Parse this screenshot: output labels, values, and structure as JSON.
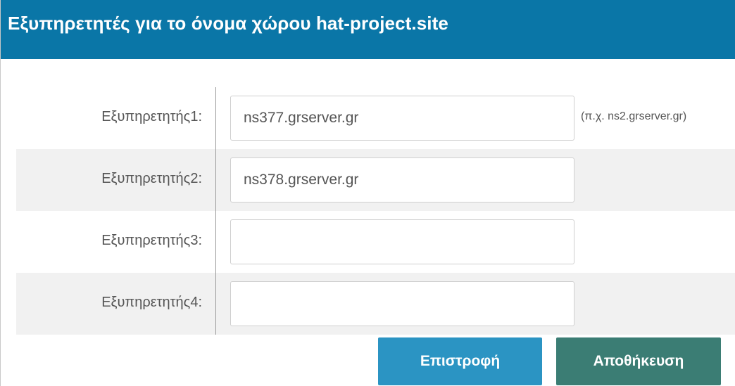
{
  "header": {
    "title": "Εξυπηρετητές για το όνομα χώρου hat-project.site"
  },
  "rows": [
    {
      "label": "Εξυπηρετητής1:",
      "value": "ns377.grserver.gr",
      "hint": "(π.χ. ns2.grserver.gr)"
    },
    {
      "label": "Εξυπηρετητής2:",
      "value": "ns378.grserver.gr"
    },
    {
      "label": "Εξυπηρετητής3:",
      "value": ""
    },
    {
      "label": "Εξυπηρετητής4:",
      "value": ""
    }
  ],
  "actions": {
    "back_label": "Επιστροφή",
    "save_label": "Αποθήκευση"
  },
  "colors": {
    "header_bg": "#0a76a7",
    "back_button": "#2b94c3",
    "save_button": "#3b7d74",
    "row_shade": "#f1f1f1"
  }
}
